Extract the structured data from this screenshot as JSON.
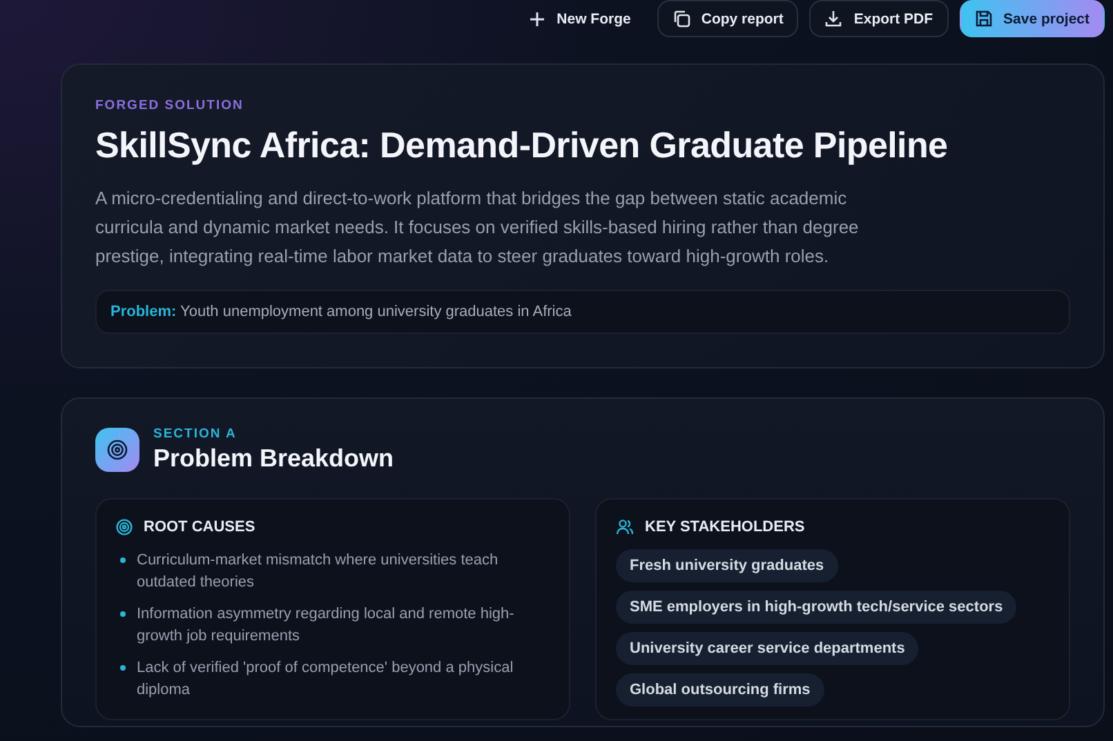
{
  "toolbar": {
    "buttons": [
      {
        "label": "New Forge",
        "kind": "plain"
      },
      {
        "label": "Copy report",
        "kind": "outline"
      },
      {
        "label": "Export PDF",
        "kind": "outline"
      },
      {
        "label": "Save project",
        "kind": "primary"
      }
    ]
  },
  "solution": {
    "eyebrow": "FORGED SOLUTION",
    "title": "SkillSync Africa: Demand-Driven Graduate Pipeline",
    "description": "A micro-credentialing and direct-to-work platform that bridges the gap between static academic curricula and dynamic market needs. It focuses on verified skills-based hiring rather than degree prestige, integrating real-time labor market data to steer graduates toward high-growth roles.",
    "problem": {
      "label": "Problem:",
      "text": "Youth unemployment among university graduates in Africa"
    }
  },
  "section": {
    "eyebrow": "SECTION A",
    "title": "Problem Breakdown",
    "root_causes": {
      "heading": "ROOT CAUSES",
      "items": [
        "Curriculum-market mismatch where universities teach outdated theories",
        "Information asymmetry regarding local and remote high-growth job requirements",
        "Lack of verified 'proof of competence' beyond a physical diploma"
      ]
    },
    "stakeholders": {
      "heading": "KEY STAKEHOLDERS",
      "items": [
        "Fresh university graduates",
        "SME employers in high-growth tech/service sectors",
        "University career service departments",
        "Global outsourcing firms"
      ]
    }
  }
}
